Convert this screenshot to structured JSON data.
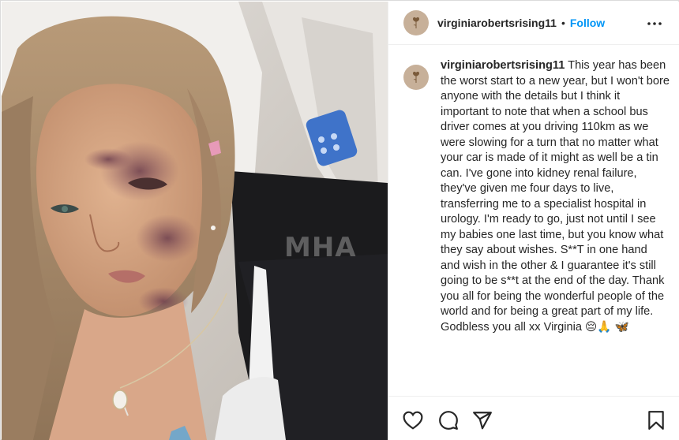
{
  "post": {
    "username": "virginiarobertsrising11",
    "separator": "•",
    "follow_label": "Follow",
    "more_icon": "more-options-icon",
    "caption_text": "This year has been the worst start to a new year, but I won't bore anyone with the details but I think it important to note that when a school bus driver comes at you driving 110km as we were slowing for a turn that no matter what your car is made of it might as well be a tin can. I've gone into kidney renal failure, they've given me four days to live, transferring me to a specialist hospital in urology. I'm ready to go, just not until I see my babies one last time, but you know what they say about wishes. S**T in one hand and wish in the other & I guarantee it's still going to be s**t at the end of the day. Thank you all for being the wonderful people of the world and for being a great part of my life. Godbless you all xx Virginia 😔🙏 🦋"
  },
  "photo": {
    "watermark": "MHA",
    "description_icon": "hospital-selfie-photo"
  },
  "actions": {
    "like_icon": "heart-icon",
    "comment_icon": "comment-icon",
    "share_icon": "send-icon",
    "save_icon": "bookmark-icon"
  },
  "colors": {
    "accent": "#0095f6",
    "text": "#262626",
    "avatar_bg": "#c7b099",
    "divider": "#efefef"
  }
}
